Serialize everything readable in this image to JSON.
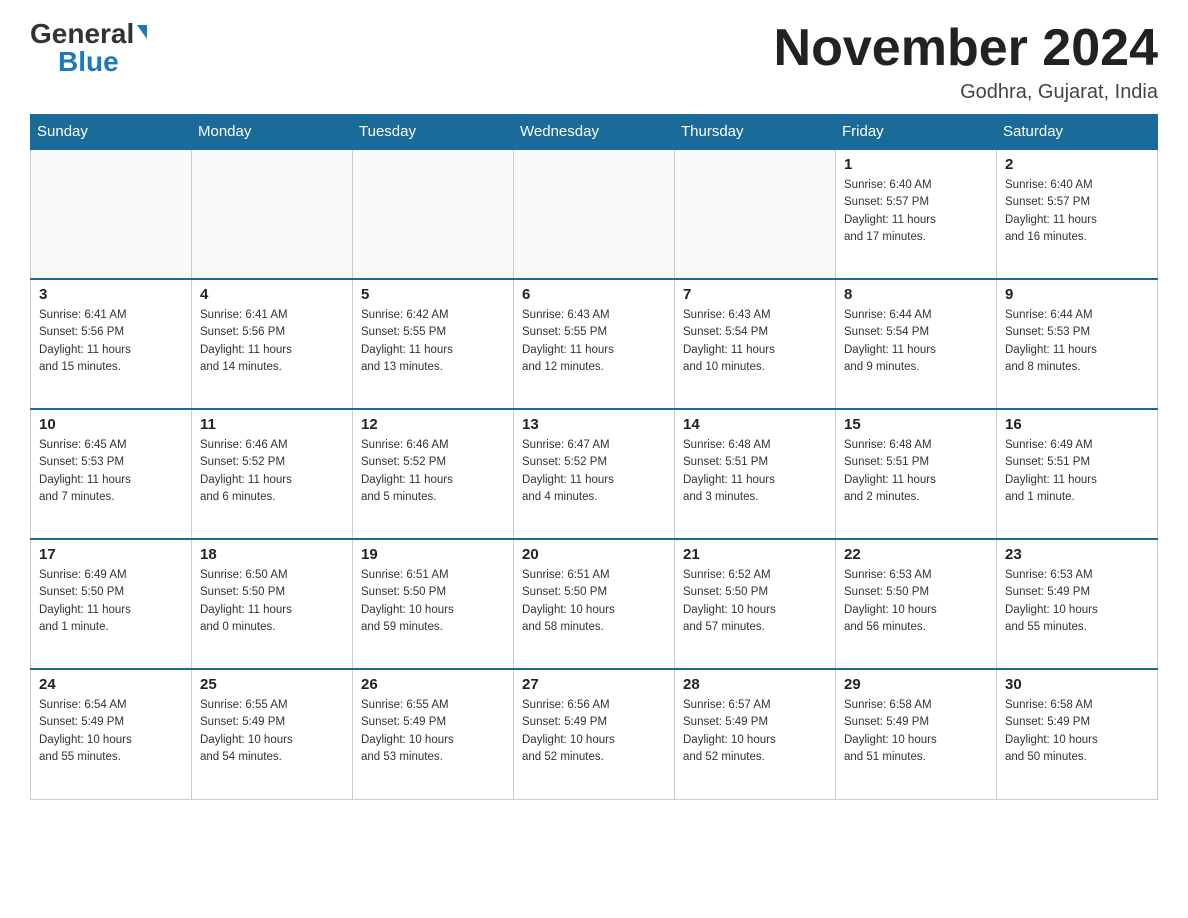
{
  "header": {
    "logo_general": "General",
    "logo_blue": "Blue",
    "month_title": "November 2024",
    "location": "Godhra, Gujarat, India"
  },
  "days_of_week": [
    "Sunday",
    "Monday",
    "Tuesday",
    "Wednesday",
    "Thursday",
    "Friday",
    "Saturday"
  ],
  "weeks": [
    [
      {
        "day": "",
        "info": ""
      },
      {
        "day": "",
        "info": ""
      },
      {
        "day": "",
        "info": ""
      },
      {
        "day": "",
        "info": ""
      },
      {
        "day": "",
        "info": ""
      },
      {
        "day": "1",
        "info": "Sunrise: 6:40 AM\nSunset: 5:57 PM\nDaylight: 11 hours\nand 17 minutes."
      },
      {
        "day": "2",
        "info": "Sunrise: 6:40 AM\nSunset: 5:57 PM\nDaylight: 11 hours\nand 16 minutes."
      }
    ],
    [
      {
        "day": "3",
        "info": "Sunrise: 6:41 AM\nSunset: 5:56 PM\nDaylight: 11 hours\nand 15 minutes."
      },
      {
        "day": "4",
        "info": "Sunrise: 6:41 AM\nSunset: 5:56 PM\nDaylight: 11 hours\nand 14 minutes."
      },
      {
        "day": "5",
        "info": "Sunrise: 6:42 AM\nSunset: 5:55 PM\nDaylight: 11 hours\nand 13 minutes."
      },
      {
        "day": "6",
        "info": "Sunrise: 6:43 AM\nSunset: 5:55 PM\nDaylight: 11 hours\nand 12 minutes."
      },
      {
        "day": "7",
        "info": "Sunrise: 6:43 AM\nSunset: 5:54 PM\nDaylight: 11 hours\nand 10 minutes."
      },
      {
        "day": "8",
        "info": "Sunrise: 6:44 AM\nSunset: 5:54 PM\nDaylight: 11 hours\nand 9 minutes."
      },
      {
        "day": "9",
        "info": "Sunrise: 6:44 AM\nSunset: 5:53 PM\nDaylight: 11 hours\nand 8 minutes."
      }
    ],
    [
      {
        "day": "10",
        "info": "Sunrise: 6:45 AM\nSunset: 5:53 PM\nDaylight: 11 hours\nand 7 minutes."
      },
      {
        "day": "11",
        "info": "Sunrise: 6:46 AM\nSunset: 5:52 PM\nDaylight: 11 hours\nand 6 minutes."
      },
      {
        "day": "12",
        "info": "Sunrise: 6:46 AM\nSunset: 5:52 PM\nDaylight: 11 hours\nand 5 minutes."
      },
      {
        "day": "13",
        "info": "Sunrise: 6:47 AM\nSunset: 5:52 PM\nDaylight: 11 hours\nand 4 minutes."
      },
      {
        "day": "14",
        "info": "Sunrise: 6:48 AM\nSunset: 5:51 PM\nDaylight: 11 hours\nand 3 minutes."
      },
      {
        "day": "15",
        "info": "Sunrise: 6:48 AM\nSunset: 5:51 PM\nDaylight: 11 hours\nand 2 minutes."
      },
      {
        "day": "16",
        "info": "Sunrise: 6:49 AM\nSunset: 5:51 PM\nDaylight: 11 hours\nand 1 minute."
      }
    ],
    [
      {
        "day": "17",
        "info": "Sunrise: 6:49 AM\nSunset: 5:50 PM\nDaylight: 11 hours\nand 1 minute."
      },
      {
        "day": "18",
        "info": "Sunrise: 6:50 AM\nSunset: 5:50 PM\nDaylight: 11 hours\nand 0 minutes."
      },
      {
        "day": "19",
        "info": "Sunrise: 6:51 AM\nSunset: 5:50 PM\nDaylight: 10 hours\nand 59 minutes."
      },
      {
        "day": "20",
        "info": "Sunrise: 6:51 AM\nSunset: 5:50 PM\nDaylight: 10 hours\nand 58 minutes."
      },
      {
        "day": "21",
        "info": "Sunrise: 6:52 AM\nSunset: 5:50 PM\nDaylight: 10 hours\nand 57 minutes."
      },
      {
        "day": "22",
        "info": "Sunrise: 6:53 AM\nSunset: 5:50 PM\nDaylight: 10 hours\nand 56 minutes."
      },
      {
        "day": "23",
        "info": "Sunrise: 6:53 AM\nSunset: 5:49 PM\nDaylight: 10 hours\nand 55 minutes."
      }
    ],
    [
      {
        "day": "24",
        "info": "Sunrise: 6:54 AM\nSunset: 5:49 PM\nDaylight: 10 hours\nand 55 minutes."
      },
      {
        "day": "25",
        "info": "Sunrise: 6:55 AM\nSunset: 5:49 PM\nDaylight: 10 hours\nand 54 minutes."
      },
      {
        "day": "26",
        "info": "Sunrise: 6:55 AM\nSunset: 5:49 PM\nDaylight: 10 hours\nand 53 minutes."
      },
      {
        "day": "27",
        "info": "Sunrise: 6:56 AM\nSunset: 5:49 PM\nDaylight: 10 hours\nand 52 minutes."
      },
      {
        "day": "28",
        "info": "Sunrise: 6:57 AM\nSunset: 5:49 PM\nDaylight: 10 hours\nand 52 minutes."
      },
      {
        "day": "29",
        "info": "Sunrise: 6:58 AM\nSunset: 5:49 PM\nDaylight: 10 hours\nand 51 minutes."
      },
      {
        "day": "30",
        "info": "Sunrise: 6:58 AM\nSunset: 5:49 PM\nDaylight: 10 hours\nand 50 minutes."
      }
    ]
  ]
}
